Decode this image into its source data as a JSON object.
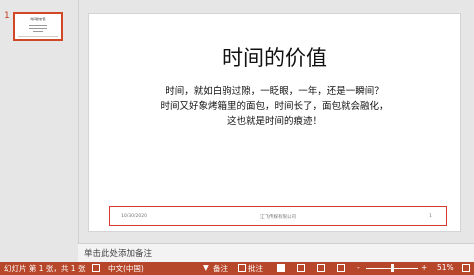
{
  "thumbnails": {
    "number": "1"
  },
  "slide": {
    "title": "时间的价值",
    "lines": [
      "时间，就如白驹过隙，一眨眼，一年，还是一瞬间？",
      "时间又好象烤箱里的面包，时间长了，面包就会融化，",
      "这也就是时间的痕迹！"
    ],
    "footer": {
      "date": "10/30/2020",
      "text": "江飞传媒有限公司",
      "page": "1"
    }
  },
  "notes": {
    "placeholder": "单击此处添加备注"
  },
  "status_bar": {
    "slide_info": "幻灯片 第 1 张，共 1 张",
    "language": "中文(中国)",
    "notes_label": "备注",
    "comments_label": "批注",
    "zoom_minus": "-",
    "zoom_plus": "+",
    "zoom": "51%",
    "zoom_fraction": 0.51
  }
}
